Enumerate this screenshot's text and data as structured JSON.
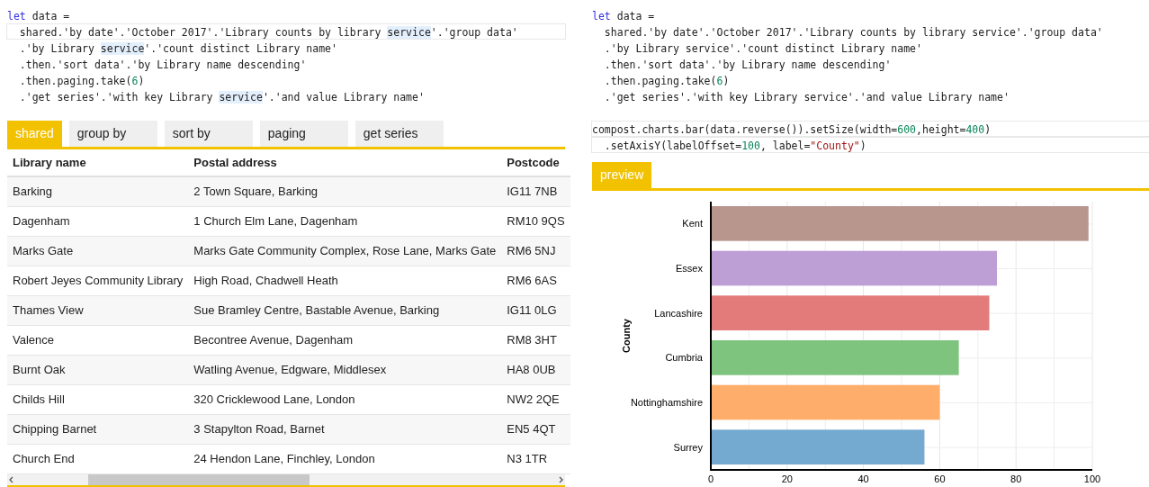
{
  "left": {
    "code": [
      {
        "active": false,
        "tokens": [
          {
            "kind": "keyword",
            "text": "let"
          },
          {
            "kind": "plain",
            "text": " data ="
          }
        ]
      },
      {
        "active": true,
        "tokens": [
          {
            "kind": "plain",
            "text": "  shared.'by date'.'October 2017'.'Library counts by library "
          },
          {
            "kind": "match",
            "text": "service"
          },
          {
            "kind": "plain",
            "text": "'.'group data'"
          }
        ]
      },
      {
        "active": false,
        "tokens": [
          {
            "kind": "plain",
            "text": "  .'by Library "
          },
          {
            "kind": "match",
            "text": "service"
          },
          {
            "kind": "plain",
            "text": "'.'count distinct Library name'"
          }
        ]
      },
      {
        "active": false,
        "tokens": [
          {
            "kind": "plain",
            "text": "  .then.'sort data'.'by Library name descending'"
          }
        ]
      },
      {
        "active": false,
        "tokens": [
          {
            "kind": "plain",
            "text": "  .then.paging.take("
          },
          {
            "kind": "number",
            "text": "6"
          },
          {
            "kind": "plain",
            "text": ")"
          }
        ]
      },
      {
        "active": false,
        "tokens": [
          {
            "kind": "plain",
            "text": "  .'get series'.'with key Library "
          },
          {
            "kind": "match",
            "text": "service"
          },
          {
            "kind": "plain",
            "text": "'.'and value Library name'"
          }
        ]
      }
    ],
    "tabs": [
      {
        "label": "shared",
        "selected": true
      },
      {
        "label": "group by",
        "selected": false
      },
      {
        "label": "sort by",
        "selected": false
      },
      {
        "label": "paging",
        "selected": false
      },
      {
        "label": "get series",
        "selected": false
      }
    ],
    "table": {
      "columns": [
        "Library name",
        "Postal address",
        "Postcode"
      ],
      "rows": [
        [
          "Barking",
          "2 Town Square, Barking",
          "IG11 7NB"
        ],
        [
          "Dagenham",
          "1 Church Elm Lane, Dagenham",
          "RM10 9QS"
        ],
        [
          "Marks Gate",
          "Marks Gate Community Complex, Rose Lane, Marks Gate",
          "RM6 5NJ"
        ],
        [
          "Robert Jeyes Community Library",
          "High Road, Chadwell Heath",
          "RM6 6AS"
        ],
        [
          "Thames View",
          "Sue Bramley Centre, Bastable Avenue, Barking",
          "IG11 0LG"
        ],
        [
          "Valence",
          "Becontree Avenue, Dagenham",
          "RM8 3HT"
        ],
        [
          "Burnt Oak",
          "Watling Avenue, Edgware, Middlesex",
          "HA8 0UB"
        ],
        [
          "Childs Hill",
          "320 Cricklewood Lane, London",
          "NW2 2QE"
        ],
        [
          "Chipping Barnet",
          "3 Stapylton Road, Barnet",
          "EN5 4QT"
        ],
        [
          "Church End",
          "24 Hendon Lane, Finchley, London",
          "N3 1TR"
        ]
      ]
    }
  },
  "right": {
    "code": [
      {
        "active": false,
        "tokens": [
          {
            "kind": "keyword",
            "text": "let"
          },
          {
            "kind": "plain",
            "text": " data ="
          }
        ]
      },
      {
        "active": false,
        "tokens": [
          {
            "kind": "plain",
            "text": "  shared.'by date'.'October 2017'.'Library counts by library service'.'group data'"
          }
        ]
      },
      {
        "active": false,
        "tokens": [
          {
            "kind": "plain",
            "text": "  .'by Library service'.'count distinct Library name'"
          }
        ]
      },
      {
        "active": false,
        "tokens": [
          {
            "kind": "plain",
            "text": "  .then.'sort data'.'by Library name descending'"
          }
        ]
      },
      {
        "active": false,
        "tokens": [
          {
            "kind": "plain",
            "text": "  .then.paging.take("
          },
          {
            "kind": "number",
            "text": "6"
          },
          {
            "kind": "plain",
            "text": ")"
          }
        ]
      },
      {
        "active": false,
        "tokens": [
          {
            "kind": "plain",
            "text": "  .'get series'.'with key Library service'.'and value Library name'"
          }
        ]
      }
    ],
    "chart_code": [
      {
        "active": true,
        "tokens": [
          {
            "kind": "plain",
            "text": "compost.charts.bar(data.reverse()).setSize(width="
          },
          {
            "kind": "number",
            "text": "600"
          },
          {
            "kind": "plain",
            "text": ",height="
          },
          {
            "kind": "number",
            "text": "400"
          },
          {
            "kind": "plain",
            "text": ")"
          }
        ]
      },
      {
        "active": true,
        "tokens": [
          {
            "kind": "plain",
            "text": "  .setAxisY(labelOffset="
          },
          {
            "kind": "number",
            "text": "100"
          },
          {
            "kind": "plain",
            "text": ", label="
          },
          {
            "kind": "string",
            "text": "\"County\""
          },
          {
            "kind": "plain",
            "text": ")"
          }
        ]
      }
    ],
    "tabs": [
      {
        "label": "preview",
        "selected": true
      }
    ],
    "chart_data": {
      "type": "bar",
      "orientation": "horizontal",
      "ylabel": "County",
      "grid": true,
      "categories": [
        "Kent",
        "Essex",
        "Lancashire",
        "Cumbria",
        "Nottinghamshire",
        "Surrey"
      ],
      "series": [
        {
          "values": [
            99,
            75,
            73,
            65,
            60,
            56
          ]
        }
      ],
      "colors": [
        "#b9968d",
        "#bd9fd6",
        "#e47b7b",
        "#7ec47e",
        "#ffad6b",
        "#74a9d0"
      ],
      "xlim": [
        0,
        100
      ],
      "xticks": [
        0,
        20,
        40,
        60,
        80,
        100
      ]
    }
  }
}
